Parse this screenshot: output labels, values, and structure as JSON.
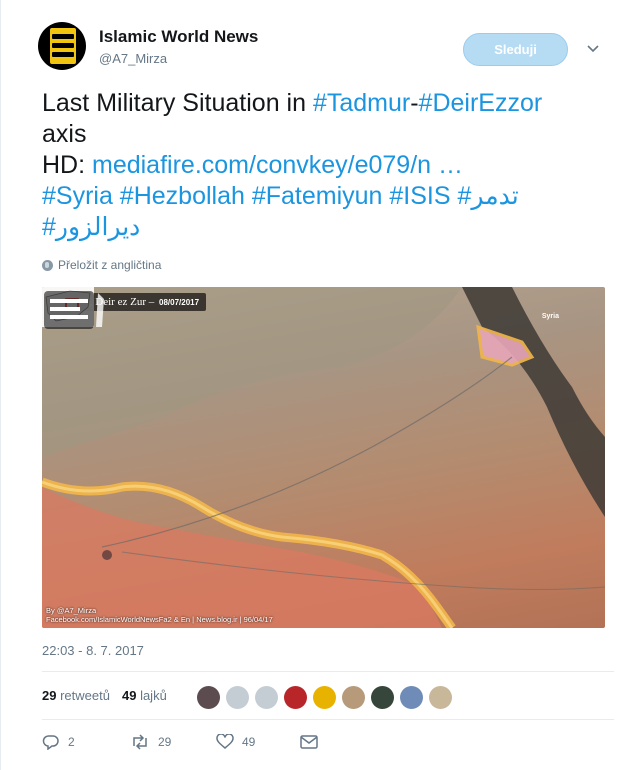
{
  "user": {
    "display_name": "Islamic World News",
    "handle": "@A7_Mirza",
    "avatar_icon": "islamic-world-news-logo"
  },
  "follow_button": {
    "label": "Sleduji"
  },
  "tweet": {
    "line1_prefix": "Last Military Situation in ",
    "line1_tag1": "#Tadmur",
    "line1_sep": "-",
    "line1_tag2": "#DeirEzzor",
    "line2": "axis",
    "line3_prefix": "HD: ",
    "line3_link": "mediafire.com/convkey/e079/n …",
    "line4_tags": "#Syria #Hezbollah #Fatemiyun #ISIS",
    "line4_arabic": "#تدمر",
    "line5_arabic": "#ديرالزور"
  },
  "translate_label": "Přeložit z angličtina",
  "map": {
    "title": "Tadmur , Deir ez Zur",
    "date": "08/07/2017",
    "inset_label": "Syria",
    "credit_line1": "By @A7_Mirza",
    "credit_line2": "Facebook.com/IslamicWorldNewsFa2 & En | News.blog.ir | 96/04/17"
  },
  "timestamp": "22:03 - 8. 7. 2017",
  "stats": {
    "retweets_count": "29",
    "retweets_label": "retweetů",
    "likes_count": "49",
    "likes_label": "lajků"
  },
  "likers": [
    {
      "color": "#5c4b4f"
    },
    {
      "color": "#c5cdd4"
    },
    {
      "color": "#c5cdd4"
    },
    {
      "color": "#b8262a"
    },
    {
      "color": "#e8b200"
    },
    {
      "color": "#b79a7a"
    },
    {
      "color": "#36463a"
    },
    {
      "color": "#6f8cb8"
    },
    {
      "color": "#c9b79a"
    }
  ],
  "actions": {
    "reply_count": "2",
    "retweet_count": "29",
    "like_count": "49"
  },
  "colors": {
    "link": "#1b95e0",
    "muted": "#657786",
    "follow_bg": "#b6dcf3"
  }
}
